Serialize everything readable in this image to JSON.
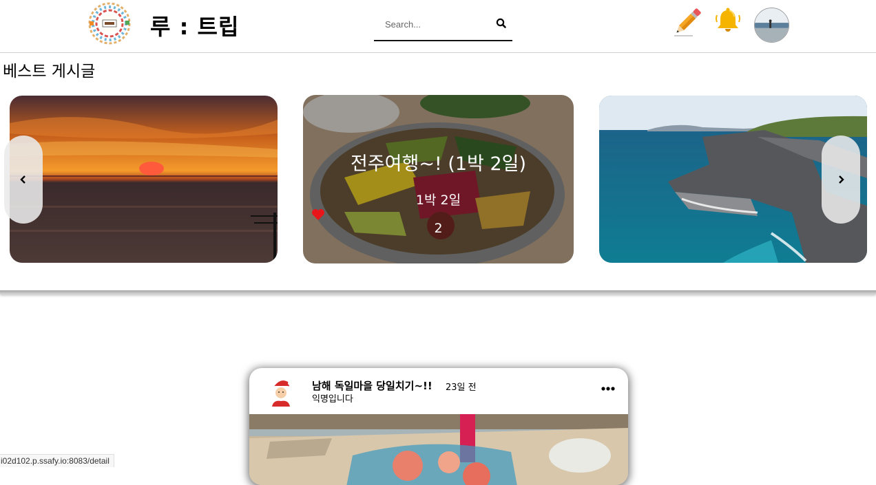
{
  "app": {
    "brand_title": "루 : 트립"
  },
  "search": {
    "placeholder": "Search..."
  },
  "header_icons": [
    "pencil-icon",
    "bell-icon",
    "search-icon"
  ],
  "best_section": {
    "title": "베스트 게시글",
    "cards": [
      {
        "image": "sunset-over-sea"
      },
      {
        "image": "bibimbap-bowl",
        "title": "전주여행~! (1박 2일)",
        "duration": "1박 2일",
        "likes": "2"
      },
      {
        "image": "jeju-coastal-cliffs"
      }
    ]
  },
  "feed": {
    "post": {
      "title": "남해 독일마을 당일치기~!!",
      "time_ago": "23일 전",
      "author": "익명입니다"
    }
  },
  "status_bar": {
    "url": "i02d102.p.ssafy.io:8083/detail"
  },
  "colors": {
    "accent_bell": "#f5b400",
    "heart": "#e8151b",
    "pencil": "#f2a019"
  }
}
